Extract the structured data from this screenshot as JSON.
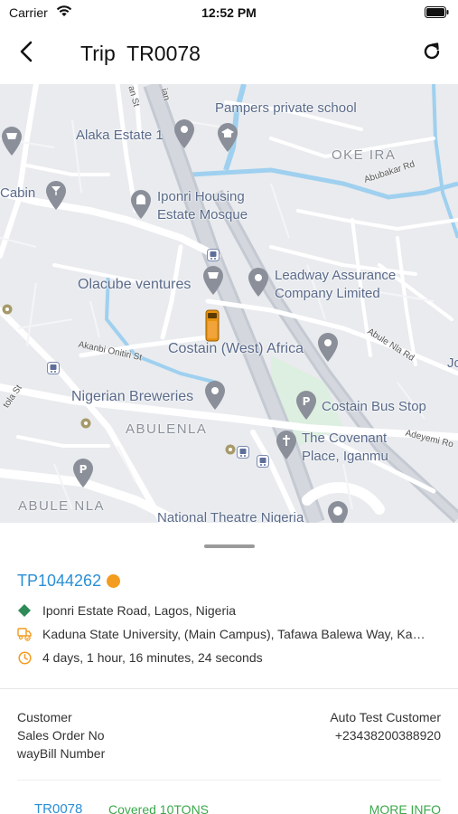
{
  "status_bar": {
    "carrier": "Carrier",
    "time": "12:52 PM"
  },
  "header": {
    "title": "Trip  TR0078",
    "back_icon": "chevron-left-icon",
    "refresh_icon": "refresh-icon"
  },
  "map": {
    "labels": {
      "pampers": "Pampers private school",
      "alaka": "Alaka Estate 1",
      "oke_ira": "OKE IRA",
      "abubakar": "Abubakar Rd",
      "cabin": "Cabin",
      "iponri_1": "Iponri Housing",
      "iponri_2": "Estate Mosque",
      "olacube": "Olacube ventures",
      "leadway_1": "Leadway Assurance",
      "leadway_2": "Company Limited",
      "akanbi": "Akanbi Onitiri St",
      "abule_nla_rd": "Abule Nla Rd",
      "costain": "Costain (West) Africa",
      "nigerian_breweries": "Nigerian Breweries",
      "costain_bus": "Costain Bus Stop",
      "abulenla": "ABULENLA",
      "covenant_1": "The Covenant",
      "covenant_2": "Place, Iganmu",
      "adeyemi": "Adeyemi Ro",
      "abule_nla": "ABULE NLA",
      "national_theatre": "National Theatre Nigeria",
      "tola": "tola St",
      "jo": "Jo",
      "an_st": "an St",
      "ian": "ian"
    }
  },
  "trip": {
    "code": "TP1044262",
    "status_color": "#f39c1f",
    "origin": "Iponri Estate Road, Lagos, Nigeria",
    "destination": "Kaduna State University, (Main Campus), Tafawa Balewa Way, Kaduna, Nigeria",
    "duration": "4 days, 1 hour, 16 minutes, 24 seconds"
  },
  "details": {
    "customer_label": "Customer",
    "customer_value": "Auto Test Customer",
    "sales_order_label": "Sales Order No",
    "sales_order_value": "+23438200388920",
    "waybill_label": "wayBill Number",
    "waybill_value": ""
  },
  "bottom": {
    "trip_code": "TR0078",
    "covered": "Covered 10TONS",
    "more_info": "MORE INFO"
  },
  "colors": {
    "accent_blue": "#2a8fd6",
    "accent_green": "#3aa84a",
    "origin_green": "#2e8b57",
    "dest_orange": "#f39c1f"
  }
}
